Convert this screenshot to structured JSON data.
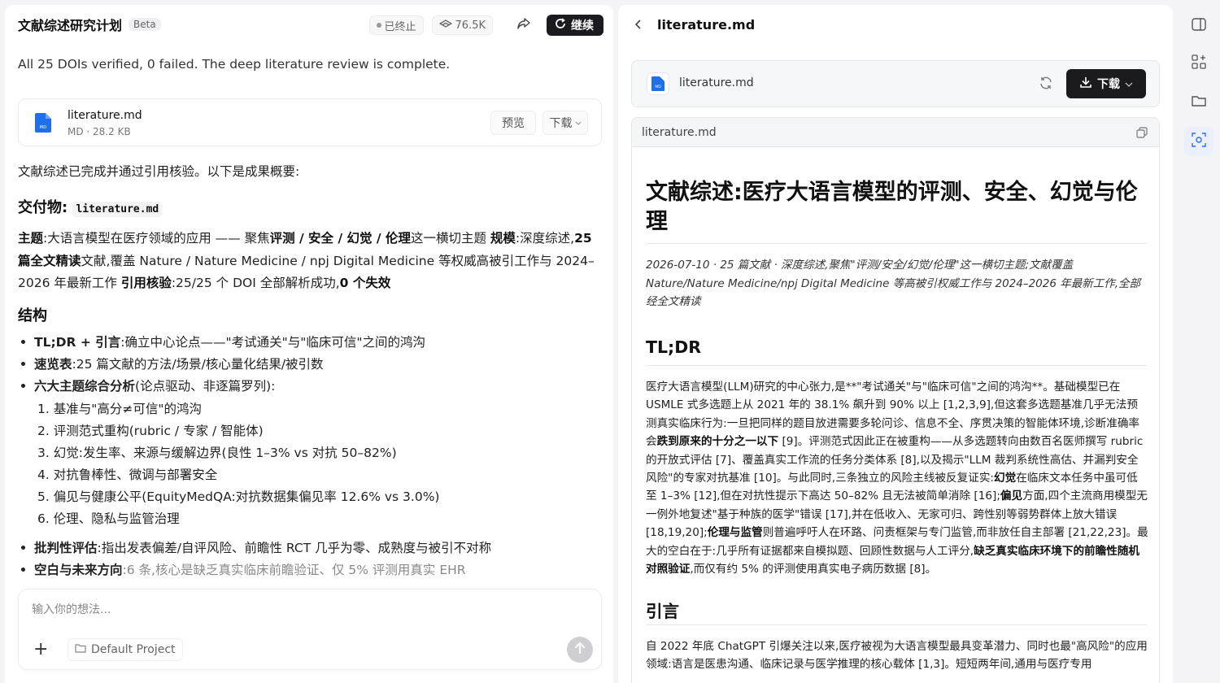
{
  "header": {
    "title": "文献综述研究计划",
    "badge": "Beta",
    "status": "已终止",
    "views": "76.5K",
    "continue_label": "继续"
  },
  "chat": {
    "summary": "All 25 DOIs verified, 0 failed. The deep literature review is complete.",
    "attachment": {
      "name": "literature.md",
      "meta": "MD · 28.2 KB",
      "icon_badge": "MD",
      "preview_label": "预览",
      "download_label": "下载"
    },
    "intro": "文献综述已完成并通过引用核验。以下是成果概要:",
    "deliverable_heading": "交付物:",
    "deliverable_file": "literature.md",
    "topic_label": "主题",
    "topic_text1": ":大语言模型在医疗领域的应用 —— 聚焦",
    "topic_bold": "评测 / 安全 / 幻觉 / 伦理",
    "topic_text2": "这一横切主题 ",
    "scale_label": "规模",
    "scale_text1": ":深度综述,",
    "scale_bold": "25 篇全文精读",
    "scale_text2": "文献,覆盖 Nature / Nature Medicine / npj Digital Medicine 等权威高被引工作与 2024–2026 年最新工作 ",
    "verify_label": "引用核验",
    "verify_text": ":25/25 个 DOI 全部解析成功,",
    "verify_bold": "0 个失效",
    "structure_heading": "结构",
    "bullets": [
      {
        "bold": "TL;DR + 引言",
        "text": ":确立中心论点——\"考试通关\"与\"临床可信\"之间的鸿沟"
      },
      {
        "bold": "速览表",
        "text": ":25 篇文献的方法/场景/核心量化结果/被引数"
      },
      {
        "bold": "六大主题综合分析",
        "text": "(论点驱动、非逐篇罗列):"
      }
    ],
    "numbered": [
      "1. 基准与\"高分≠可信\"的鸿沟",
      "2. 评测范式重构(rubric / 专家 / 智能体)",
      "3. 幻觉:发生率、来源与缓解边界(良性 1–3% vs 对抗 50–82%)",
      "4. 对抗鲁棒性、微调与部署安全",
      "5. 偏见与健康公平(EquityMedQA:对抗数据集偏见率 12.6% vs 3.0%)",
      "6. 伦理、隐私与监管治理"
    ],
    "bullets2": [
      {
        "bold": "批判性评估",
        "text": ":指出发表偏差/自评风险、前瞻性 RCT 几乎为零、成熟度与被引不对称"
      },
      {
        "bold": "空白与未来方向",
        "text": ":6 条,核心是缺乏真实临床前瞻验证、仅 5% 评测用真实 EHR"
      }
    ],
    "input_placeholder": "输入你的想法...",
    "project_label": "Default Project"
  },
  "preview": {
    "title": "literature.md",
    "file_name": "literature.md",
    "file_badge": "MD",
    "download_label": "下载",
    "doc_bar_name": "literature.md",
    "doc_title": "文献综述:医疗大语言模型的评测、安全、幻觉与伦理",
    "doc_meta": "2026-07-10 · 25 篇文献 · 深度综述,聚焦\"评测/安全/幻觉/伦理\"这一横切主题;文献覆盖 Nature/Nature Medicine/npj Digital Medicine 等高被引权威工作与 2024–2026 年最新工作,全部经全文精读",
    "tldr_heading": "TL;DR",
    "tldr_p1": "医疗大语言模型(LLM)研究的中心张力,是**\"考试通关\"与\"临床可信\"之间的鸿沟**。基础模型已在 USMLE 式多选题上从 2021 年的 38.1% 飙升到 90% 以上 [1,2,3,9],但这套多选题基准几乎无法预测真实临床行为:一旦把同样的题目放进需要多轮问诊、信息不全、序贯决策的智能体环境,诊断准确率会",
    "tldr_b1": "跌到原来的十分之一以下",
    "tldr_p2": " [9]。评测范式因此正在被重构——从多选题转向由数百名医师撰写 rubric 的开放式评估 [7]、覆盖真实工作流的任务分类体系 [8],以及揭示\"LLM 裁判系统性高估、并漏判安全风险\"的专家对抗基准 [10]。与此同时,三条独立的风险主线被反复证实:",
    "tldr_b2": "幻觉",
    "tldr_p3": "在临床文本任务中虽可低至 1–3% [12],但在对抗性提示下高达 50–82% 且无法被简单消除 [16];",
    "tldr_b3": "偏见",
    "tldr_p4": "方面,四个主流商用模型无一例外地复述\"基于种族的医学\"错误 [17],并在低收入、无家可归、跨性别等弱势群体上放大错误 [18,19,20];",
    "tldr_b4": "伦理与监管",
    "tldr_p5": "则普遍呼吁人在环路、问责框架与专门监管,而非放任自主部署 [21,22,23]。最大的空白在于:几乎所有证据都来自模拟题、回顾性数据与人工评分,",
    "tldr_b5": "缺乏真实临床环境下的前瞻性随机对照验证",
    "tldr_p6": ",而仅有约 5% 的评测使用真实电子病历数据 [8]。",
    "intro_heading": "引言",
    "intro_p": "自 2022 年底 ChatGPT 引爆关注以来,医疗被视为大语言模型最具变革潜力、同时也最\"高风险\"的应用领域:语言是医患沟通、临床记录与医学推理的核心载体 [1,3]。短短两年间,通用与医疗专用"
  },
  "colors": {
    "accent_dark": "#1b1b1f",
    "file_blue": "#1f6feb",
    "active_rail": "#eaf0ff"
  }
}
